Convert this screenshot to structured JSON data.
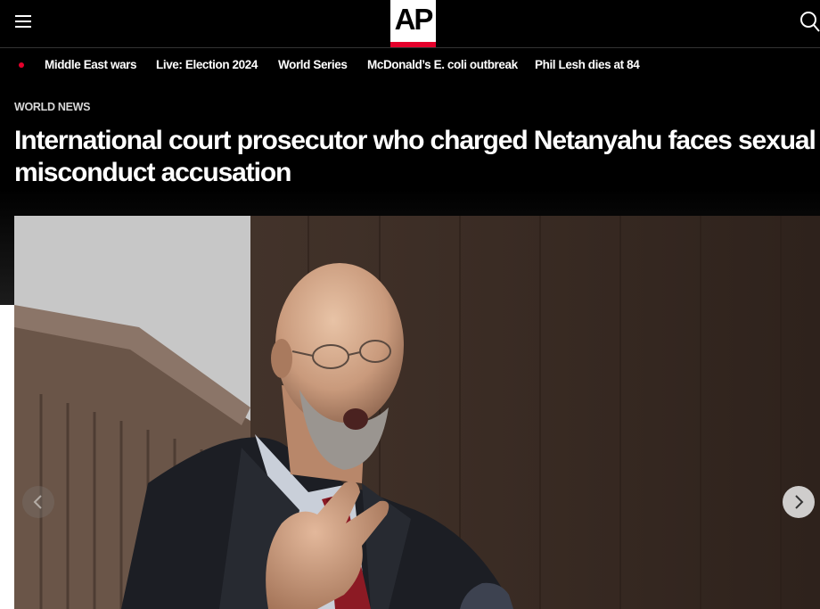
{
  "header": {
    "logo_text": "AP",
    "menu_icon": "hamburger-menu-icon",
    "search_icon": "search-icon",
    "accent_color": "#e4002b"
  },
  "trending": {
    "items": [
      {
        "label": "Middle East wars"
      },
      {
        "label": "Live: Election 2024"
      },
      {
        "label": "World Series"
      },
      {
        "label": "McDonald’s E. coli outbreak"
      },
      {
        "label": "Phil Lesh dies at 84"
      }
    ]
  },
  "article": {
    "section": "WORLD NEWS",
    "headline": "International court prosecutor who charged Netanyahu faces sexual misconduct accusation"
  },
  "gallery": {
    "prev_icon": "chevron-left-icon",
    "next_icon": "chevron-right-icon"
  }
}
